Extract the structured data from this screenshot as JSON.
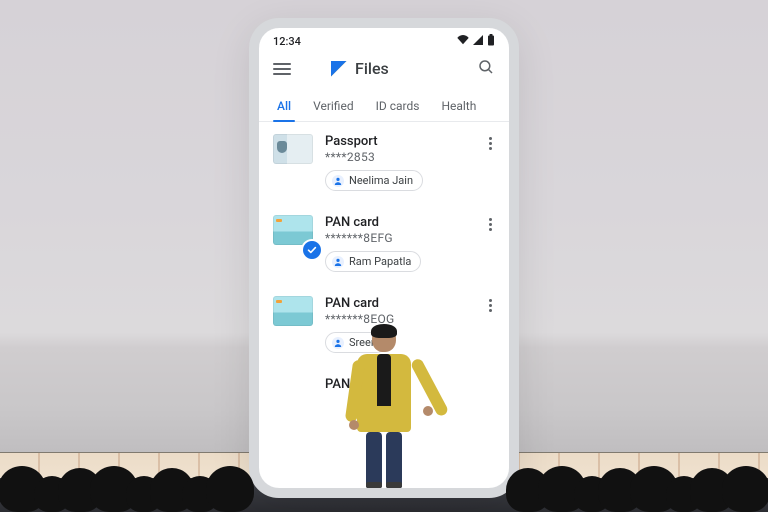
{
  "statusbar": {
    "time": "12:34"
  },
  "appbar": {
    "title": "Files"
  },
  "tabs": [
    {
      "label": "All",
      "active": true
    },
    {
      "label": "Verified",
      "active": false
    },
    {
      "label": "ID cards",
      "active": false
    },
    {
      "label": "Health",
      "active": false
    }
  ],
  "documents": [
    {
      "title": "Passport",
      "masked": "****2853",
      "owner": "Neelima Jain",
      "thumb": "passport",
      "checked": false
    },
    {
      "title": "PAN card",
      "masked": "*******8EFG",
      "owner": "Ram Papatla",
      "thumb": "pan",
      "checked": true
    },
    {
      "title": "PAN card",
      "masked": "*******8EOG",
      "owner": "Sreen",
      "thumb": "pan",
      "checked": false
    },
    {
      "title": "PAN card",
      "masked": "",
      "owner": "",
      "thumb": "pan",
      "checked": false
    }
  ]
}
